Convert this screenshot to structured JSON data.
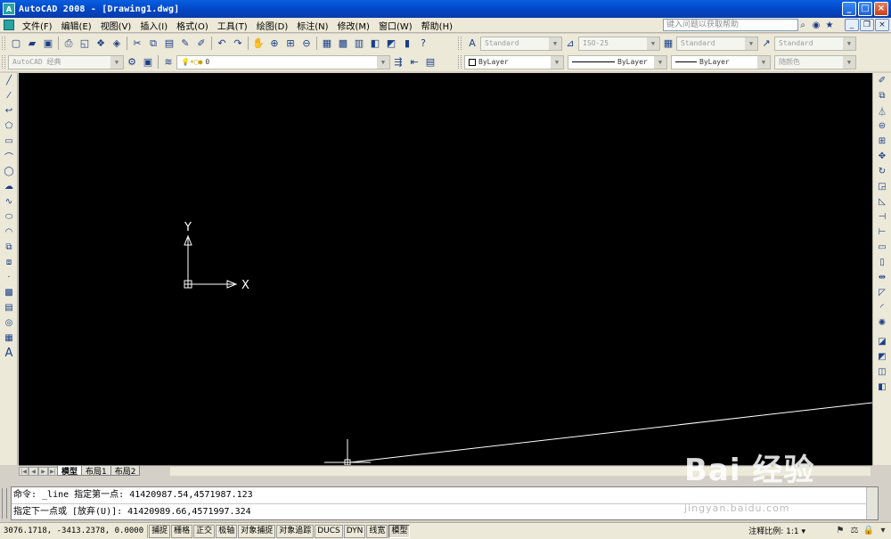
{
  "window": {
    "app_icon": "autocad-app-icon",
    "title": "AutoCAD 2008 - [Drawing1.dwg]",
    "controls": {
      "minimize": "_",
      "maximize": "□",
      "close": "×"
    }
  },
  "menubar": {
    "items": [
      "文件(F)",
      "编辑(E)",
      "视图(V)",
      "插入(I)",
      "格式(O)",
      "工具(T)",
      "绘图(D)",
      "标注(N)",
      "修改(M)",
      "窗口(W)",
      "帮助(H)"
    ],
    "help_search_placeholder": "键入问题以获取帮助",
    "doc_controls": {
      "minimize": "_",
      "restore": "❐",
      "close": "×"
    }
  },
  "toolbars": {
    "standard_icons": [
      "new-icon",
      "open-icon",
      "save-icon",
      "plot-icon",
      "plot-preview-icon",
      "publish-icon",
      "3d-dwf-icon",
      "cut-icon",
      "copy-icon",
      "paste-icon",
      "match-properties-icon",
      "block-editor-icon",
      "undo-icon",
      "redo-icon",
      "pan-icon",
      "zoom-realtime-icon",
      "zoom-window-icon",
      "zoom-previous-icon",
      "properties-icon",
      "design-center-icon",
      "tool-palettes-icon",
      "sheet-set-icon",
      "markup-icon",
      "quickcalc-icon",
      "help-icon"
    ],
    "styles": {
      "text_style": "Standard",
      "dim_style": "ISO-25",
      "table_style": "Standard",
      "multileader_style": "Standard"
    },
    "workspace": "AutoCAD 经典",
    "layer_value": "0",
    "properties": {
      "color": "ByLayer",
      "linetype": "ByLayer",
      "lineweight": "ByLayer",
      "plot_style": "随颜色"
    }
  },
  "left_toolbar_icons": [
    "line-icon",
    "construction-line-icon",
    "polyline-icon",
    "polygon-icon",
    "rectangle-icon",
    "arc-icon",
    "circle-icon",
    "revision-cloud-icon",
    "spline-icon",
    "ellipse-icon",
    "ellipse-arc-icon",
    "insert-block-icon",
    "make-block-icon",
    "point-icon",
    "hatch-icon",
    "gradient-icon",
    "region-icon",
    "table-icon",
    "multiline-text-icon"
  ],
  "right_toolbar_icons": [
    "erase-icon",
    "copy-object-icon",
    "mirror-icon",
    "offset-icon",
    "array-icon",
    "move-icon",
    "rotate-icon",
    "scale-icon",
    "stretch-icon",
    "trim-icon",
    "extend-icon",
    "break-at-point-icon",
    "break-icon",
    "join-icon",
    "chamfer-icon",
    "fillet-icon",
    "explode-icon",
    "draworder-front-icon",
    "draworder-back-icon",
    "draworder-above-icon",
    "draworder-under-icon"
  ],
  "canvas": {
    "ucs_x_label": "X",
    "ucs_y_label": "Y"
  },
  "layout_tabs": [
    "模型",
    "布局1",
    "布局2"
  ],
  "command_line": {
    "line1": "命令: _line 指定第一点: 41420987.54,4571987.123",
    "line2": "指定下一点或 [放弃(U)]: 41420989.66,4571997.324"
  },
  "statusbar": {
    "coordinates": "3076.1718, -3413.2378, 0.0000",
    "toggles": [
      {
        "label": "捕捉",
        "on": false
      },
      {
        "label": "栅格",
        "on": false
      },
      {
        "label": "正交",
        "on": false
      },
      {
        "label": "极轴",
        "on": false
      },
      {
        "label": "对象捕捉",
        "on": false
      },
      {
        "label": "对象追踪",
        "on": false
      },
      {
        "label": "DUCS",
        "on": false
      },
      {
        "label": "DYN",
        "on": false
      },
      {
        "label": "线宽",
        "on": false
      },
      {
        "label": "模型",
        "on": true
      }
    ],
    "annotation_scale_label": "注释比例:",
    "annotation_scale_value": "1:1"
  },
  "watermark": {
    "main": "Bai 经验",
    "sub": "jingyan.baidu.com"
  }
}
